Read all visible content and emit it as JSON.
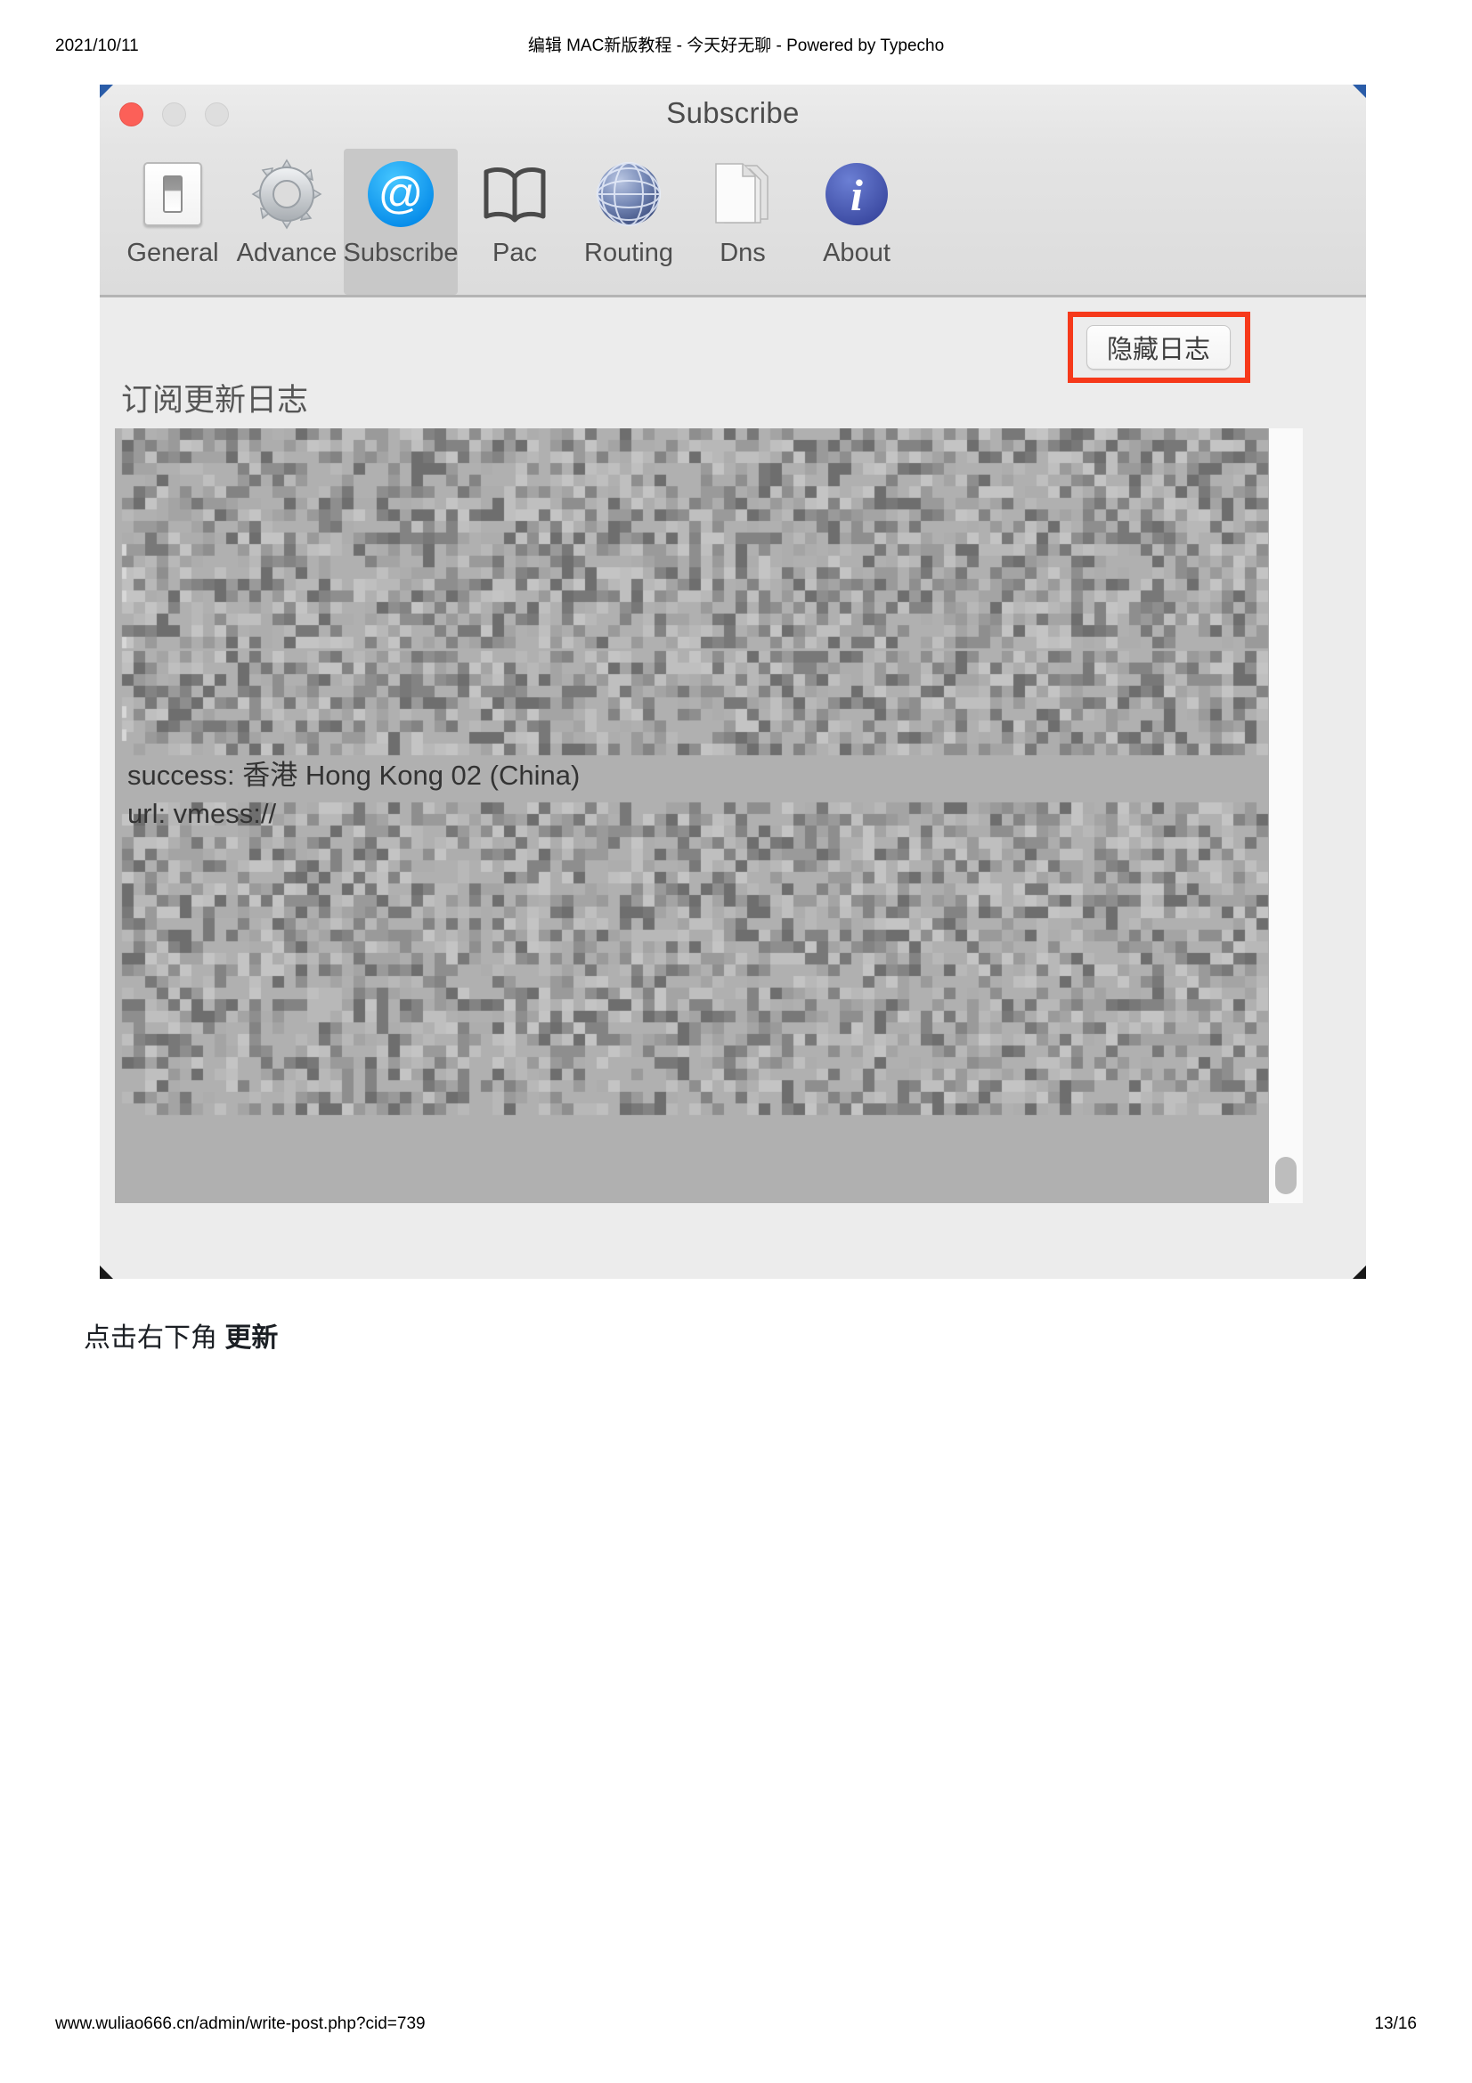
{
  "page": {
    "header_date": "2021/10/11",
    "header_title": "编辑 MAC新版教程 - 今天好无聊 - Powered by Typecho",
    "footer_url": "www.wuliao666.cn/admin/write-post.php?cid=739",
    "footer_page": "13/16"
  },
  "app_window": {
    "title": "Subscribe",
    "traffic_lights": {
      "close": "close-button",
      "minimize": "minimize-button",
      "zoom": "zoom-button"
    },
    "toolbar": {
      "items": [
        {
          "label": "General",
          "icon": "toggle-switch-icon",
          "selected": false
        },
        {
          "label": "Advance",
          "icon": "gear-icon",
          "selected": false
        },
        {
          "label": "Subscribe",
          "icon": "at-sign-icon",
          "selected": true
        },
        {
          "label": "Pac",
          "icon": "open-book-icon",
          "selected": false
        },
        {
          "label": "Routing",
          "icon": "globe-icon",
          "selected": false
        },
        {
          "label": "Dns",
          "icon": "documents-icon",
          "selected": false
        },
        {
          "label": "About",
          "icon": "info-icon",
          "selected": false
        }
      ]
    },
    "content": {
      "section_title": "订阅更新日志",
      "hide_log_button": "隐藏日志",
      "log_lines": [
        "success: 香港 Hong Kong 02 (China)",
        "url: vmess://"
      ],
      "redacted_note": "mosaic-censored-log-text"
    }
  },
  "caption": {
    "text_prefix": "点击右下角 ",
    "text_bold": "更新"
  },
  "colors": {
    "annotation": "#f6391a",
    "selected_tab": "#c8c8c8",
    "log_background": "#b0b0b0",
    "close_light": "#fc6058",
    "at_icon": "#0aa3f5",
    "info_icon": "#4357b5"
  }
}
